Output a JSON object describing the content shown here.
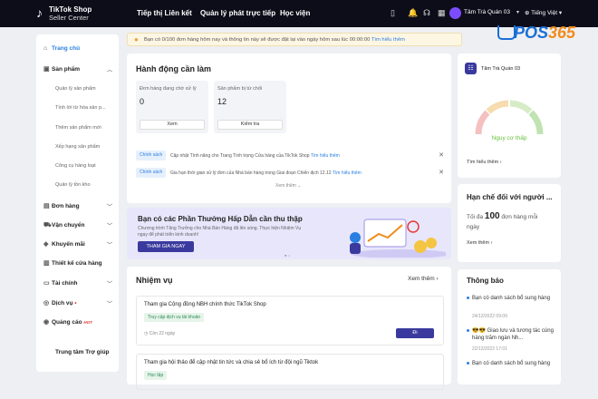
{
  "topbar": {
    "logo_line1": "TikTok Shop",
    "logo_line2": "Seller Center",
    "nav": [
      "Tiếp thị Liên kết",
      "Quản lý phát trực tiếp",
      "Học viện"
    ],
    "user_name": "Tâm Trà Quán 03",
    "language": "Tiếng Việt"
  },
  "sidebar": {
    "home": "Trang chủ",
    "products": "Sản phẩm",
    "product_items": [
      "Quản lý sản phẩm",
      "Tính lời từ hóa sản p...",
      "Thêm sản phẩm mới",
      "Xếp hạng sản phẩm",
      "Công cụ hàng loạt",
      "Quản lý tồn kho"
    ],
    "sections": [
      "Đơn hàng",
      "Vận chuyển",
      "Khuyến mãi",
      "Thiết kế cửa hàng",
      "Tài chính",
      "Dịch vụ",
      "Quảng cáo",
      "Trung tâm Trợ giúp"
    ],
    "ads_badge": "HOT"
  },
  "banner": {
    "text": "Bạn có 0/100 đơn hàng hôm nay và thông tin này sẽ được đặt lại vào ngày hôm sau lúc 00:00:00",
    "link": "Tìm hiểu thêm"
  },
  "watermark": {
    "p": "POS",
    "n": "365"
  },
  "action": {
    "title": "Hành động cần làm",
    "stats": [
      {
        "label": "Đơn hàng đang chờ xử lý",
        "value": "0",
        "button": "Xem"
      },
      {
        "label": "Sản phẩm bị từ chối",
        "value": "12",
        "button": "Kiểm tra"
      }
    ],
    "policies": [
      {
        "tag": "Chính sách",
        "text": "Cập nhật Tính năng cho Trang Tính trọng Cửa hàng của TikTok Shop",
        "link": "Tìm hiểu thêm"
      },
      {
        "tag": "Chính sách",
        "text": "Gia hạn thời gian xử lý đơn của Nhà bán hàng trong Giai đoạn Chiến dịch 12.12",
        "link": "Tìm hiểu thêm"
      }
    ],
    "more": "Xem thêm"
  },
  "promo": {
    "title": "Bạn có các Phần Thưởng Hấp Dẫn cần thu thập",
    "desc": "Chương trình Tăng Trưởng cho Nhà Bán Hàng đã lên sóng. Thực hiện Nhiệm Vụ ngay để phát triển kinh doanh!",
    "button": "THAM GIA NGAY"
  },
  "tasks": {
    "title": "Nhiệm vụ",
    "more": "Xem thêm",
    "items": [
      {
        "title": "Tham gia Cộng đồng NBH chính thức TikTok Shop",
        "tag": "Truy cập dịch vụ tài khoản",
        "remain": "Còn 22 ngày",
        "button": "Đi"
      },
      {
        "title": "Tham gia hội thảo để cập nhật tin tức và chia sẻ bổ ích từ đội ngũ Tiktok",
        "tag": "Học tập"
      }
    ]
  },
  "shop": {
    "avatar": "☷",
    "name": "Tâm Trà Quán 03",
    "gauge_label": "Nguy cơ thấp",
    "gauge_colors": [
      "#f4c0c0",
      "#f6dcae",
      "#d7ecc6",
      "#bfe3b1"
    ],
    "link": "Tìm hiểu thêm"
  },
  "limit": {
    "title": "Hạn chế đối với người ...",
    "prefix": "Tối đa",
    "number": "100",
    "suffix": "đơn hàng mỗi",
    "line2": "ngày",
    "more": "Xem thêm"
  },
  "notice": {
    "title": "Thông báo",
    "items": [
      {
        "text": "Bạn có danh sách bổ sung hàng",
        "date": "24/12/2022 09:09"
      },
      {
        "text": "😎😎 Giao lưu và tương tác cùng hàng trăm ngàn Nh...",
        "date": "22/12/2022 17:01"
      },
      {
        "text": "Bạn có danh sách bổ sung hàng",
        "date": ""
      }
    ]
  }
}
